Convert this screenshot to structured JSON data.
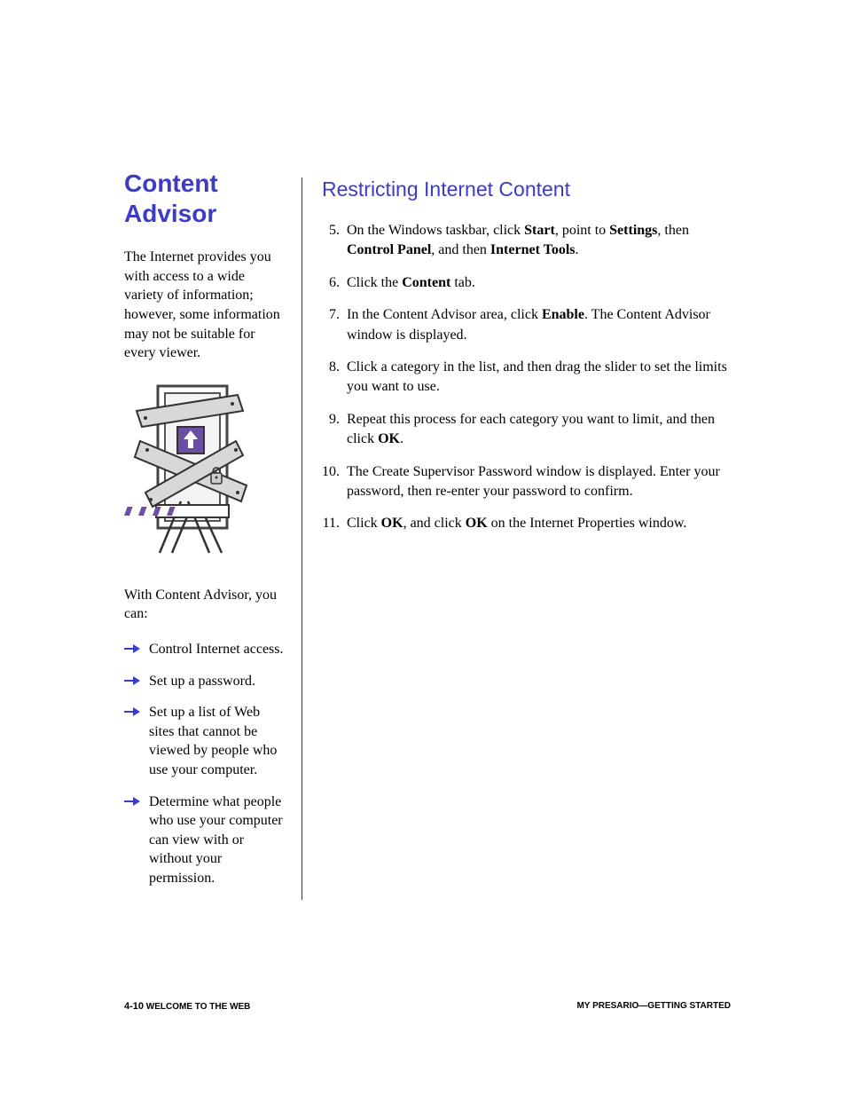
{
  "sidebar": {
    "title": "Content Advisor",
    "intro": "The Internet provides you with access to a wide variety of information; however, some information may not be suitable for every viewer.",
    "lead": "With Content Advisor, you can:",
    "bullets": [
      "Control Internet access.",
      "Set up a password.",
      "Set up a list of Web sites that cannot be viewed by people who use your computer.",
      "Determine what people who use your computer can view with or without your permission."
    ]
  },
  "main": {
    "heading": "Restricting Internet Content",
    "steps": [
      {
        "n": "5.",
        "pre": "On the Windows taskbar, click ",
        "b1": "Start",
        "mid1": ", point to ",
        "b2": "Settings",
        "mid2": ", then ",
        "b3": "Control Panel",
        "mid3": ", and then ",
        "b4": "Internet Tools",
        "post": "."
      },
      {
        "n": "6.",
        "pre": "Click the ",
        "b1": "Content",
        "post": " tab."
      },
      {
        "n": "7.",
        "pre": "In the Content Advisor area, click ",
        "b1": "Enable",
        "post": ". The Content Advisor window is displayed."
      },
      {
        "n": "8.",
        "plain": "Click a category in the list, and then drag the slider to set the limits you want to use."
      },
      {
        "n": "9.",
        "pre": "Repeat this process for each category you want to limit, and then click ",
        "b1": "OK",
        "post": "."
      },
      {
        "n": "10.",
        "plain": "The Create Supervisor Password window is displayed. Enter your password, then re-enter your password to confirm."
      },
      {
        "n": "11.",
        "pre": "Click ",
        "b1": "OK",
        "mid1": ", and click ",
        "b2": "OK",
        "post": " on the Internet Properties window."
      }
    ]
  },
  "footer": {
    "left_num": "4-10",
    "left_text": " WELCOME TO THE WEB",
    "right_text": "MY PRESARIO—GETTING STARTED"
  }
}
